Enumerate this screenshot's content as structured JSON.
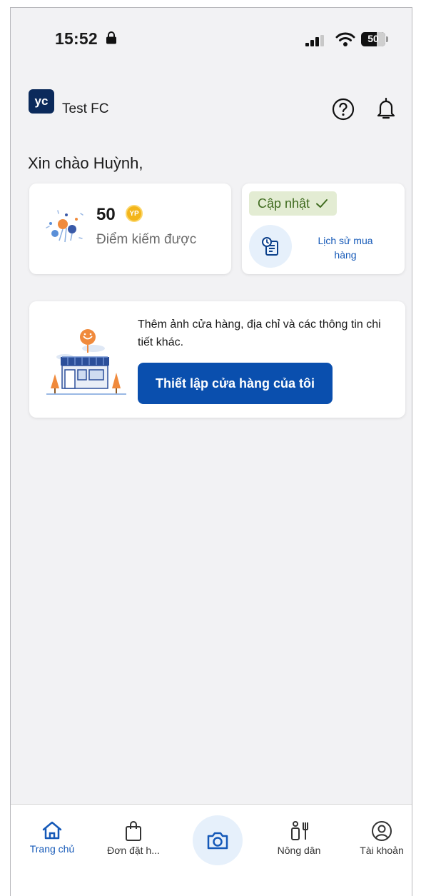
{
  "status_bar": {
    "time": "15:52",
    "battery": "50"
  },
  "header": {
    "logo_text": "YC",
    "store_name": "Test FC"
  },
  "greeting": "Xin chào Huỳnh,",
  "points_card": {
    "value": "50",
    "badge": "YP",
    "label": "Điểm kiếm được"
  },
  "update_card": {
    "badge_label": "Cập nhật",
    "history_label": "Lịch sử mua hàng"
  },
  "setup_card": {
    "text": "Thêm ảnh cửa hàng, địa chỉ và các thông tin chi tiết khác.",
    "button_label": "Thiết lập cửa hàng của tôi"
  },
  "bottom_nav": {
    "items": [
      {
        "label": "Trang chủ",
        "icon": "home-icon",
        "active": true
      },
      {
        "label": "Đơn đặt h...",
        "icon": "shopping-bag-icon",
        "active": false
      },
      {
        "label": "",
        "icon": "camera-icon",
        "active": false
      },
      {
        "label": "Nông dân",
        "icon": "farmer-icon",
        "active": false
      },
      {
        "label": "Tài khoản",
        "icon": "account-icon",
        "active": false
      }
    ]
  },
  "colors": {
    "primary": "#0a4fae",
    "link": "#1559b8",
    "badge_bg": "#e3ecd3",
    "coin": "#f3b51a"
  }
}
